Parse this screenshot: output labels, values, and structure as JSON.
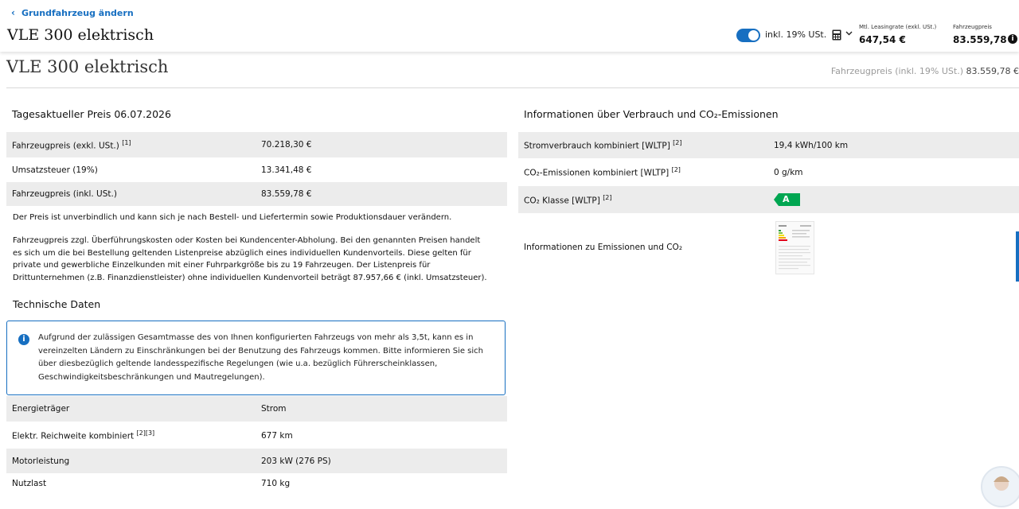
{
  "header": {
    "back_label": "Grundfahrzeug ändern",
    "title": "VLE 300 elektrisch",
    "vat_toggle_label": "inkl. 19% USt.",
    "lease_label": "Mtl. Leasingrate (exkl. USt.)",
    "lease_value": "647,54 €",
    "price_label": "Fahrzeugpreis",
    "price_value": "83.559,78 €",
    "info_glyph": "i",
    "icons": [
      "chevron-left-icon",
      "toggle-switch",
      "calculator-icon",
      "chevron-down-icon",
      "info-icon"
    ]
  },
  "subheader": {
    "title": "VLE 300 elektrisch",
    "price_label": "Fahrzeugpreis (inkl. 19% USt.)",
    "price_value": "83.559,78 €"
  },
  "price_section": {
    "heading": "Tagesaktueller Preis 06.07.2026",
    "rows": [
      {
        "label": "Fahrzeugpreis (exkl. USt.)",
        "sup": "[1]",
        "value": "70.218,30 €"
      },
      {
        "label": "Umsatzsteuer (19%)",
        "sup": "",
        "value": "13.341,48 €"
      },
      {
        "label": "Fahrzeugpreis (inkl. USt.)",
        "sup": "",
        "value": "83.559,78 €"
      }
    ],
    "note1": "Der Preis ist unverbindlich und kann sich je nach Bestell- und Liefertermin sowie Produktionsdauer verändern.",
    "note2": "Fahrzeugpreis zzgl. Überführungskosten oder Kosten bei Kundencenter-Abholung. Bei den genannten Preisen handelt es sich um die bei Bestellung geltenden Listenpreise abzüglich eines individuellen Kundenvorteils. Diese gelten für private und gewerbliche Einzelkunden mit einer Fuhrparkgröße bis zu 19 Fahrzeugen. Der Listenpreis für Drittunternehmen (z.B. Finanzdienstleister) ohne individuellen Kundenvorteil beträgt 87.957,66 € (inkl. Umsatzsteuer)."
  },
  "tech_section": {
    "heading": "Technische Daten",
    "notice": "Aufgrund der zulässigen Gesamtmasse des von Ihnen konfigurierten Fahrzeugs von mehr als 3,5t, kann es in vereinzelten Ländern zu Einschränkungen bei der Benutzung des Fahrzeugs kommen. Bitte informieren Sie sich über diesbezüglich geltende landesspezifische Regelungen (wie u.a. bezüglich Führerscheinklassen, Geschwindigkeitsbeschränkungen und Mautregelungen).",
    "notice_glyph": "i",
    "rows": [
      {
        "label": "Energieträger",
        "sup": "",
        "value": "Strom"
      },
      {
        "label": "Elektr. Reichweite kombiniert",
        "sup": "[2][3]",
        "value": "677 km"
      },
      {
        "label": "Motorleistung",
        "sup": "",
        "value": "203 kW (276 PS)"
      },
      {
        "label": "Nutzlast",
        "sup": "",
        "value": "710 kg"
      }
    ]
  },
  "emissions_section": {
    "heading": "Informationen über Verbrauch und CO₂-Emissionen",
    "rows": [
      {
        "label": "Stromverbrauch kombiniert [WLTP]",
        "sup": "[2]",
        "value": "19,4 kWh/100 km"
      },
      {
        "label": "CO₂-Emissionen kombiniert [WLTP]",
        "sup": "[2]",
        "value": "0 g/km"
      },
      {
        "label": "CO₂ Klasse [WLTP]",
        "sup": "[2]",
        "value": "A"
      }
    ],
    "info_label": "Informationen zu Emissionen und CO₂",
    "energy_class_color": "#00a651"
  },
  "colors": {
    "accent": "#176fc1",
    "row_grey": "#ececec"
  }
}
